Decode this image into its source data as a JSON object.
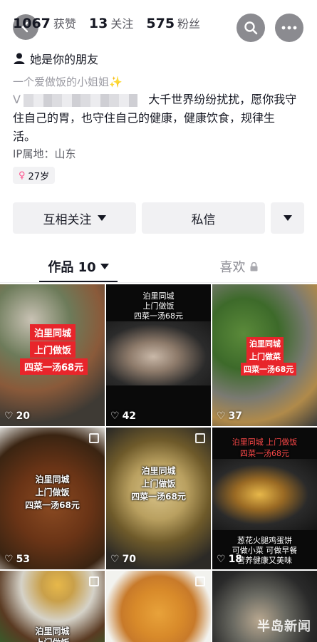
{
  "header": {
    "stats": [
      {
        "num": "1067",
        "label": "获赞"
      },
      {
        "num": "13",
        "label": "关注"
      },
      {
        "num": "575",
        "label": "粉丝"
      }
    ],
    "search_icon": "search-icon",
    "more_icon": "more-icon",
    "back_icon": "back-icon"
  },
  "profile": {
    "friend_text": "她是你的朋友",
    "bio_line1": "一个爱做饭的小姐姐",
    "bio_prefix": "V",
    "bio_text_a": "大千世界纷纷扰扰，愿你我守",
    "bio_text_b": "住自己的胃，也守住自己的健康，健康饮食，规律生",
    "bio_text_c": "活。",
    "ip": "IP属地：山东",
    "age": "27岁",
    "accent_pink": "#ff4f8b"
  },
  "actions": {
    "follow_label": "互相关注",
    "message_label": "私信"
  },
  "tabs": {
    "works_label": "作品 10",
    "likes_label": "喜欢"
  },
  "videos": [
    {
      "likes": "20",
      "tag1": "泊里同城",
      "tag2": "上门做饭",
      "tag3": "四菜一汤68元"
    },
    {
      "likes": "42",
      "t1": "泊里同城",
      "t2": "上门做饭",
      "t3": "四菜一汤68元"
    },
    {
      "likes": "37",
      "tag1": "泊里同城",
      "tag2": "上门做菜",
      "tag3": "四菜一汤68元"
    },
    {
      "likes": "53",
      "t1": "泊里同城",
      "t2": "上门做饭",
      "t3": "四菜一汤68元"
    },
    {
      "likes": "70",
      "t1": "泊里同城",
      "t2": "上门做饭",
      "t3": "四菜一汤68元"
    },
    {
      "likes": "18",
      "top1": "泊里同城 上门做饭",
      "top2": "四菜一汤68元",
      "b1": "葱花火腿鸡蛋饼",
      "b2": "可做小菜 可做早餐",
      "b3": "营养健康又美味"
    },
    {
      "t1": "泊里同城",
      "t2": "上门做饭"
    },
    {},
    {
      "watermark": "半岛新闻"
    }
  ],
  "colors": {
    "brand_red": "#e8252b",
    "text_primary": "#161823",
    "text_secondary": "#9a9aa2"
  }
}
